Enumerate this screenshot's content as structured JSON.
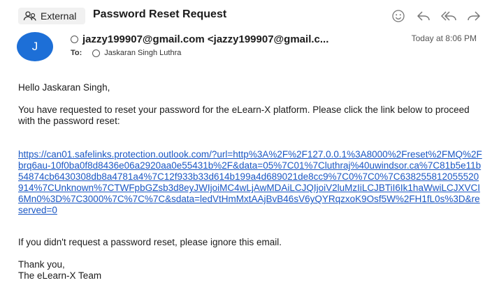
{
  "header": {
    "badge_label": "External",
    "subject": "Password Reset Request"
  },
  "icons": {
    "external": "people-icon",
    "emoji": "smiley-icon",
    "reply": "reply-icon",
    "reply_all": "reply-all-icon",
    "forward": "forward-icon"
  },
  "sender": {
    "avatar_initial": "J",
    "from": "jazzy199907@gmail.com <jazzy199907@gmail.c...",
    "timestamp": "Today at 8:06 PM",
    "to_label": "To:",
    "to_name": "Jaskaran Singh Luthra"
  },
  "message": {
    "greeting": "Hello Jaskaran Singh,",
    "intro": "You have requested to reset your password for the eLearn-X platform. Please click the link below to proceed with the password reset:",
    "link": "https://can01.safelinks.protection.outlook.com/?url=http%3A%2F%2F127.0.0.1%3A8000%2Freset%2FMQ%2Fbrq6au-10f0ba0f8d8436e06a2920aa0e55431b%2F&data=05%7C01%7Cluthraj%40uwindsor.ca%7C81b5e11b54874cb6430308db8a4781a4%7C12f933b33d614b199a4d689021de8cc9%7C0%7C0%7C638255812055520914%7CUnknown%7CTWFpbGZsb3d8eyJWIjoiMC4wLjAwMDAiLCJQIjoiV2luMzIiLCJBTiI6Ik1haWwiLCJXVCI6Mn0%3D%7C3000%7C%7C%7C&sdata=ledVtHmMxtAAjBvB46sV6yQYRqzxoK9Osf5W%2FH1fL0s%3D&reserved=0",
    "ignore": "If you didn't request a password reset, please ignore this email.",
    "signoff": "Thank you,",
    "signature": "The eLearn-X Team"
  },
  "colors": {
    "avatar": "#1d6fd7",
    "link": "#1a57c4",
    "badge_bg": "#f1f1f1"
  }
}
